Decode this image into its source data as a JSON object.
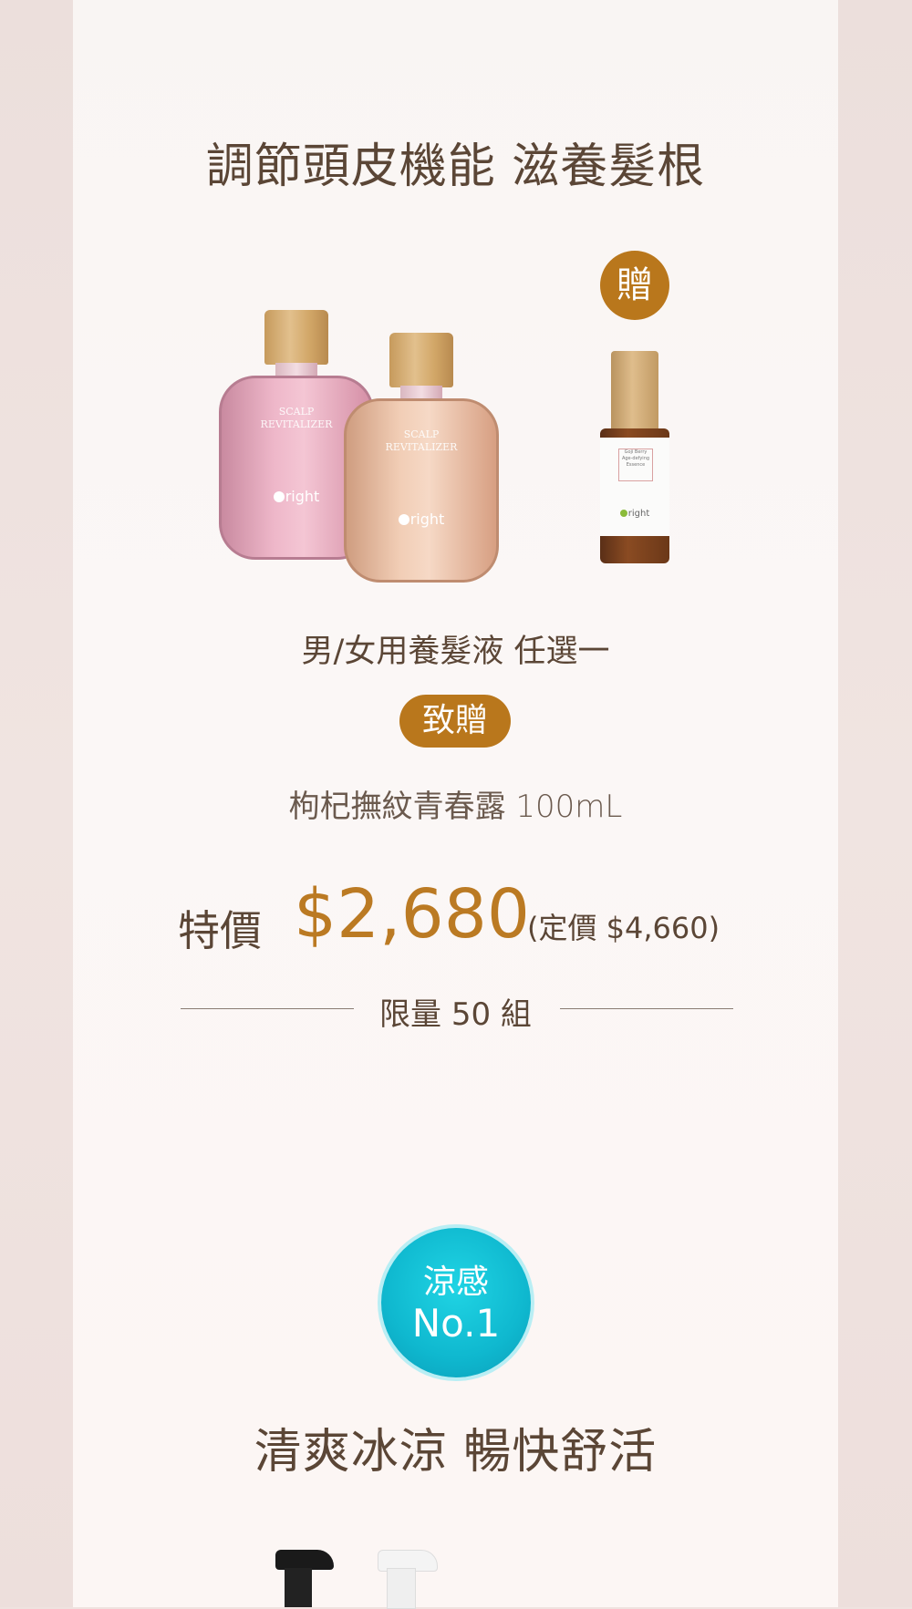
{
  "promo1": {
    "heading": "調節頭皮機能 滋養髮根",
    "gift_badge": "贈",
    "bottle_label_line1": "SCALP",
    "bottle_label_line2": "REVITALIZER",
    "brand": "right",
    "spray_label": "Goji Berry Age-defying Essence",
    "product_line": "男/女用養髮液 任選一",
    "gift_pill": "致贈",
    "gift_item": "枸杞撫紋青春露 100mL",
    "special_label": "特價",
    "price": "$2,680",
    "original_price": "(定價 $4,660)",
    "limit": "限量 50 組"
  },
  "promo2": {
    "badge_line1": "涼感",
    "badge_line2": "No.1",
    "heading": "清爽冰涼 暢快舒活"
  },
  "colors": {
    "accent": "#b9771c",
    "price": "#bb7a23",
    "text": "#5b4636",
    "cool": "#12bcd2"
  }
}
